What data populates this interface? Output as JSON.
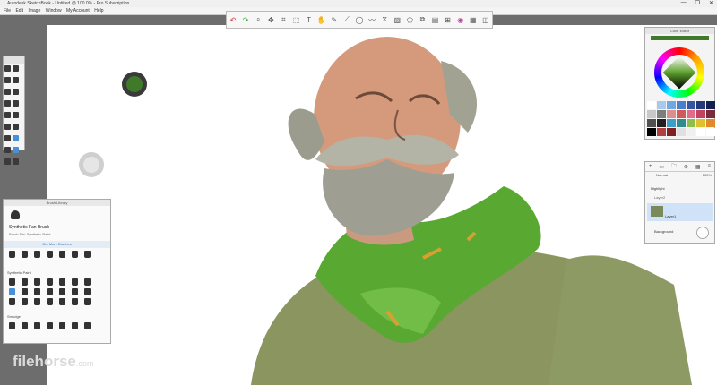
{
  "titlebar": {
    "title": "Autodesk SketchBook - Untitled @ 100.0% - Pro Subscription",
    "controls": [
      "—",
      "❐",
      "✕"
    ]
  },
  "menu": [
    "File",
    "Edit",
    "Image",
    "Window",
    "My Account",
    "Help"
  ],
  "toolbar": {
    "icons": [
      "undo-icon",
      "redo-icon",
      "zoom-icon",
      "move-icon",
      "crop-icon",
      "transform-icon",
      "text-icon",
      "hand-icon",
      "pencil-icon",
      "ruler-icon",
      "ellipse-icon",
      "french-curve-icon",
      "symmetry-icon",
      "fill-icon",
      "shape-icon",
      "copy-icon",
      "layer-icon",
      "grid-icon",
      "colorwheel-icon",
      "palette-icon",
      "brush-icon"
    ],
    "glyphs": [
      "↶",
      "↷",
      "⌕",
      "✥",
      "⌗",
      "⬚",
      "T",
      "✋",
      "✎",
      "⟋",
      "◯",
      "〰",
      "⧖",
      "▧",
      "⬠",
      "⧉",
      "▤",
      "⊞",
      "◉",
      "▦",
      "◫"
    ]
  },
  "brush_library": {
    "header": "Brush Library",
    "brush_name": "Synthetic Fan Brush",
    "brush_sub": "Brush Set: Synthetic Paint",
    "get_more": "Get More Brushes",
    "section1": "Synthetic Paint",
    "section2": "Smudge"
  },
  "color_editor": {
    "header": "Color Editor",
    "current_color": "#3e7a2a",
    "palette": [
      "#ffffff",
      "#a8c8ec",
      "#6fa7e0",
      "#4a7fd0",
      "#34569c",
      "#23397a",
      "#141e4f",
      "#c8c8c8",
      "#7d7d7d",
      "#dc8f8f",
      "#d05a5a",
      "#e06b8b",
      "#c0445f",
      "#7a2a3a",
      "#505050",
      "#202020",
      "#3aa0c8",
      "#2e8c8c",
      "#8cc04a",
      "#e0c030",
      "#e08a2a",
      "#000000",
      "#b04040",
      "#802020",
      "#e0e0e0",
      "#f0f0f0",
      "#ffffff",
      "#ffffff"
    ]
  },
  "layers": {
    "tools": [
      "+",
      "▭",
      "🗀",
      "⊕",
      "▦",
      "≡"
    ],
    "blend_mode": "Normal",
    "opacity": "100%",
    "rows": [
      {
        "name": "Highlight",
        "sub": "Layer2",
        "active": false
      },
      {
        "name": "Layer1",
        "sub": "",
        "active": true
      },
      {
        "name": "Background",
        "sub": "",
        "active": false
      }
    ]
  },
  "watermark": {
    "main": "filehorse",
    "suffix": ".com"
  }
}
